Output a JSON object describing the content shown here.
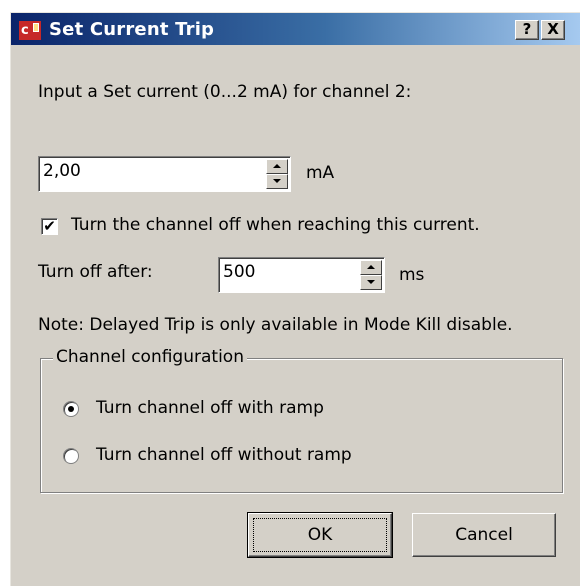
{
  "window": {
    "title": "Set Current Trip",
    "help_label": "?",
    "close_label": "X",
    "icon": "app-icon-red"
  },
  "prompt": "Input a Set current (0...2 mA) for channel 2:",
  "current": {
    "value": "2,00",
    "unit": "mA"
  },
  "trip_checkbox": {
    "checked": true,
    "check_mark": "✔",
    "label": "Turn the channel off when reaching this current."
  },
  "delay": {
    "label": "Turn off after:",
    "value": "500",
    "unit": "ms"
  },
  "note": "Note: Delayed Trip is only available in Mode Kill disable.",
  "channel_config": {
    "title": "Channel configuration",
    "options": [
      {
        "label": "Turn channel off with ramp",
        "selected": true
      },
      {
        "label": "Turn channel off without ramp",
        "selected": false
      }
    ]
  },
  "buttons": {
    "ok": "OK",
    "cancel": "Cancel"
  },
  "colors": {
    "dialog_bg": "#d4d0c8",
    "title_start": "#0a246a",
    "title_end": "#a6caf0"
  }
}
